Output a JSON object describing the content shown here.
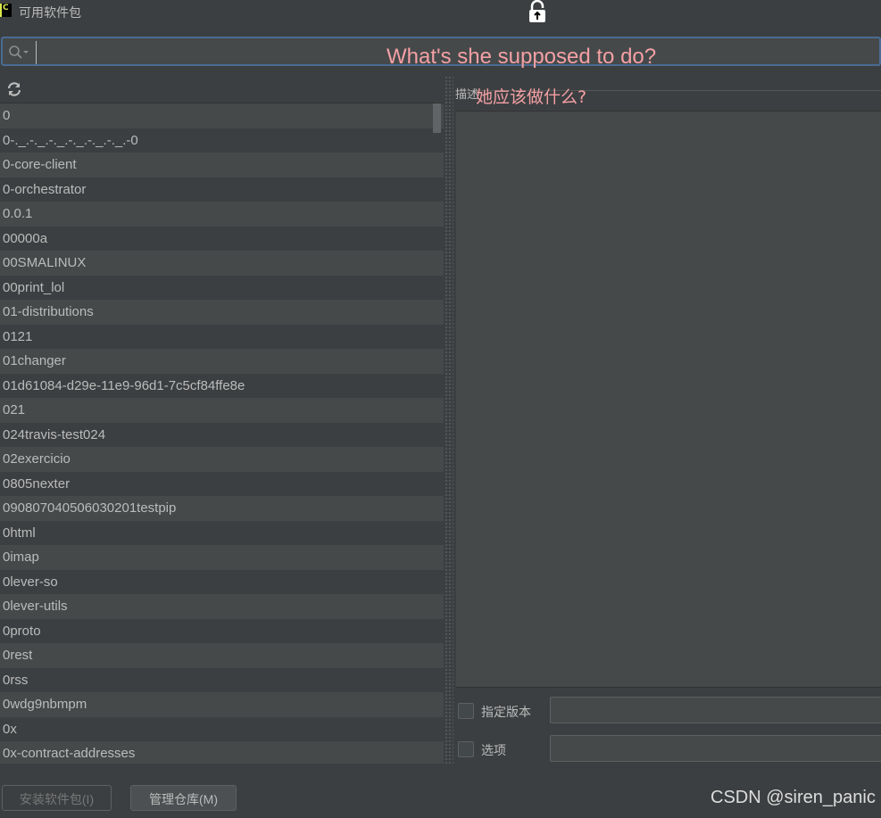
{
  "window": {
    "title": "可用软件包"
  },
  "search": {
    "value": "",
    "placeholder": ""
  },
  "overlay": {
    "english": "What's she supposed to do?",
    "chinese": "她应该做什么?"
  },
  "packages": [
    "0",
    "0-._.-._.-._.-._.-._.-._.-0",
    "0-core-client",
    "0-orchestrator",
    "0.0.1",
    "00000a",
    "00SMALINUX",
    "00print_lol",
    "01-distributions",
    "0121",
    "01changer",
    "01d61084-d29e-11e9-96d1-7c5cf84ffe8e",
    "021",
    "024travis-test024",
    "02exercicio",
    "0805nexter",
    "090807040506030201testpip",
    "0html",
    "0imap",
    "0lever-so",
    "0lever-utils",
    "0proto",
    "0rest",
    "0rss",
    "0wdg9nbmpm",
    "0x",
    "0x-contract-addresses"
  ],
  "description": {
    "header": "描述"
  },
  "options": {
    "version_label": "指定版本",
    "options_label": "选项",
    "version_value": "",
    "options_value": ""
  },
  "buttons": {
    "install": "安装软件包(I)",
    "manage": "管理仓库(M)"
  },
  "watermark": "CSDN @siren_panic",
  "icons": [
    "app-logo-icon",
    "lock-icon",
    "search-icon",
    "refresh-icon"
  ]
}
